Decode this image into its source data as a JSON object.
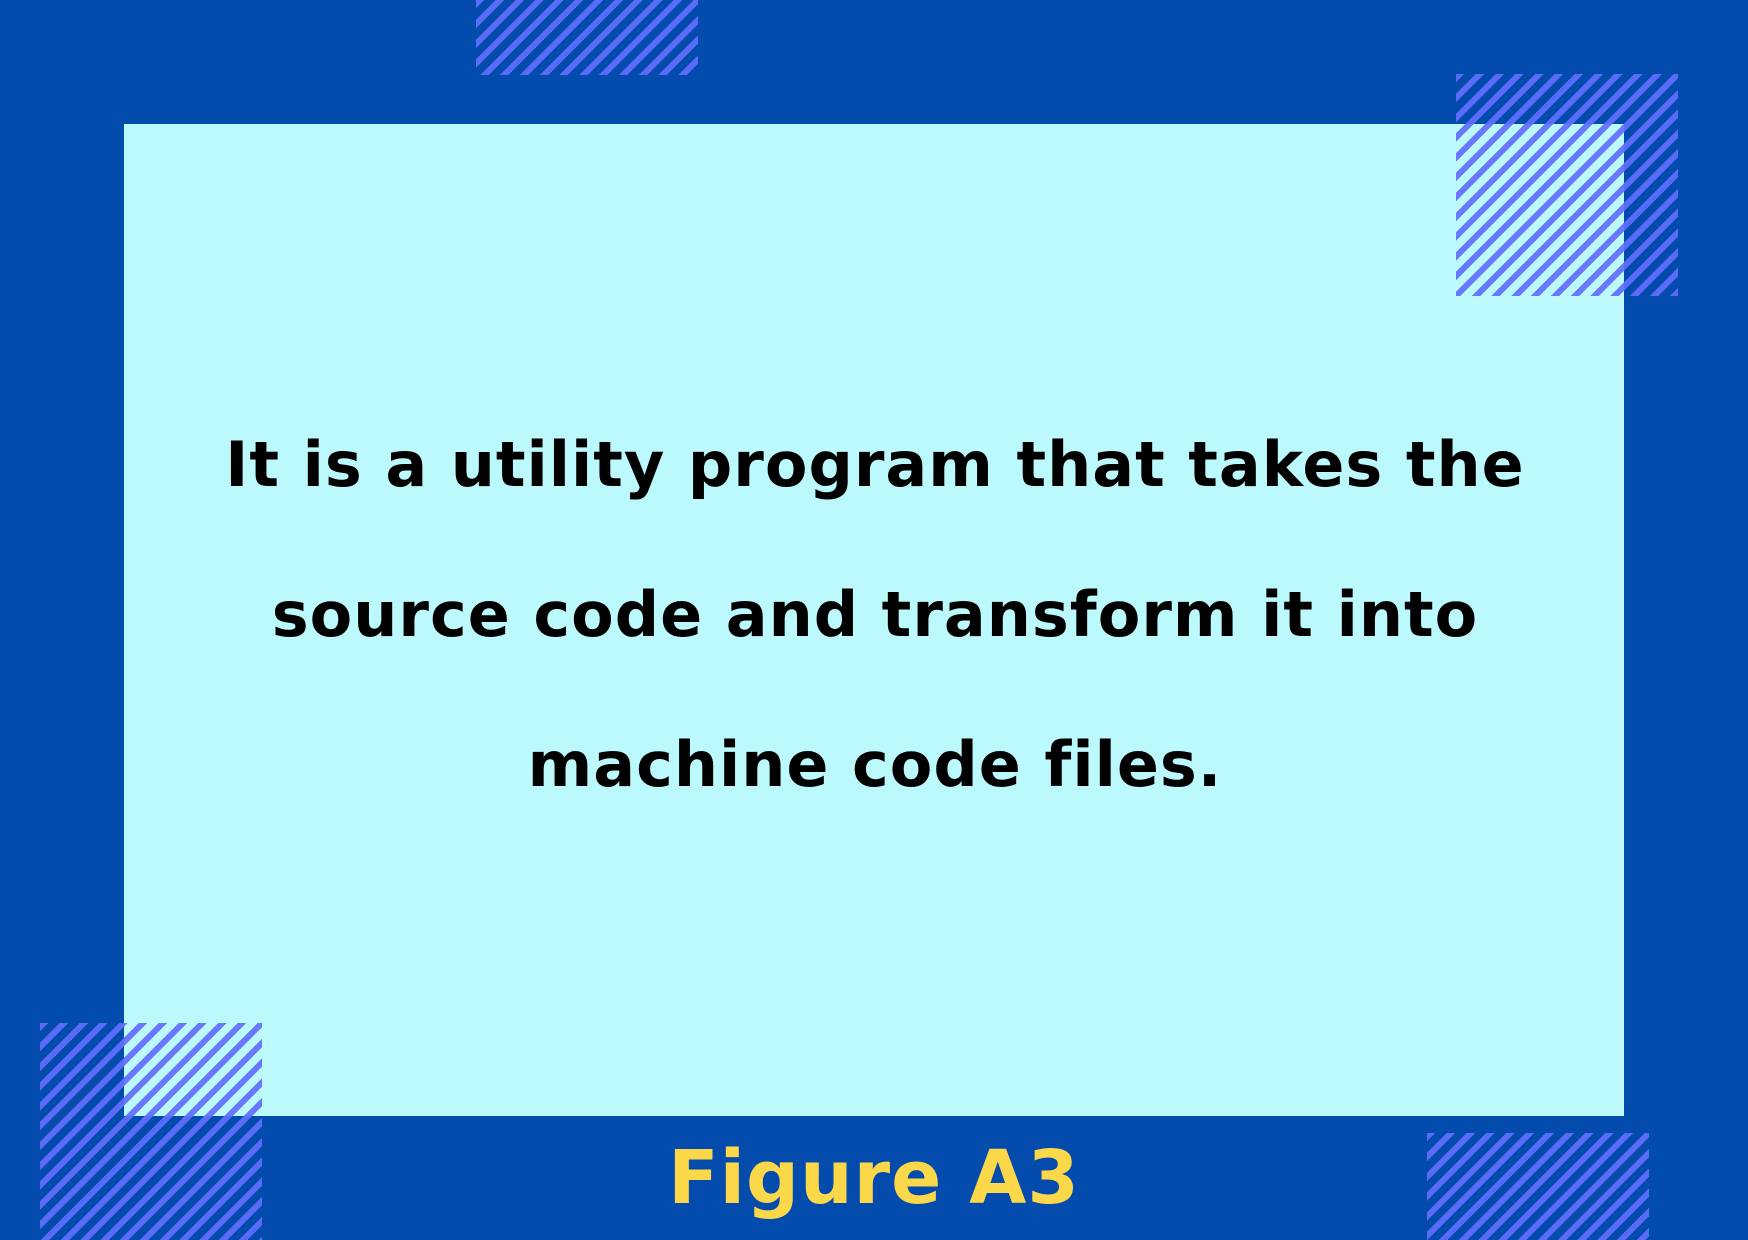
{
  "card": {
    "text": "It is a utility program that takes the source code and transform it into machine code files."
  },
  "caption": {
    "label": "Figure A3"
  },
  "colors": {
    "frame_background": "#034bad",
    "card_background": "#bbf9fc",
    "stripe_pattern": "#626eff",
    "caption_text": "#fbd84a",
    "body_text": "#000000"
  }
}
